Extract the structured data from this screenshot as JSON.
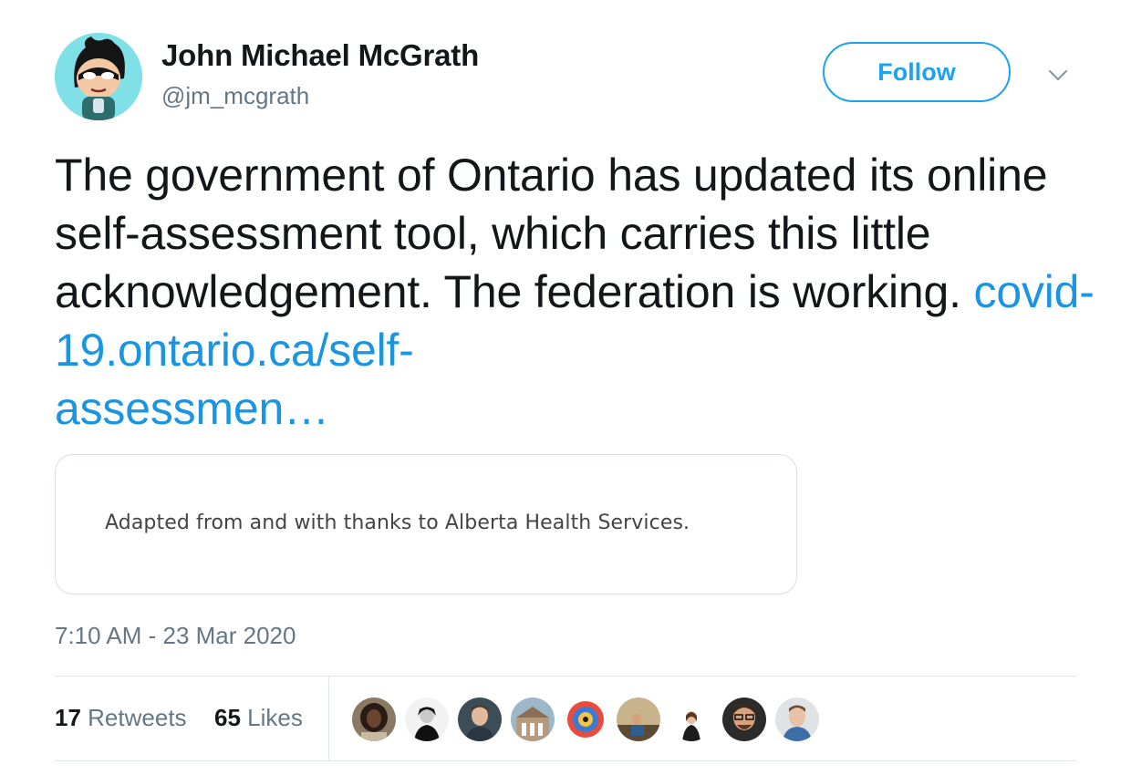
{
  "author": {
    "name": "John Michael McGrath",
    "handle": "@jm_mcgrath"
  },
  "follow_label": "Follow",
  "tweet": {
    "text": "The government of Ontario has updated its online self-assessment tool, which carries this little acknowledgement. The federation is working.",
    "link_line1": "covid-19.ontario.ca/self-",
    "link_line2": "assessmen…"
  },
  "card": {
    "text": "Adapted from and with thanks to Alberta Health Services."
  },
  "timestamp": "7:10 AM - 23 Mar 2020",
  "stats": {
    "retweets_count": "17",
    "retweets_label": "Retweets",
    "likes_count": "65",
    "likes_label": "Likes"
  },
  "colors": {
    "accent": "#1da1f2",
    "link": "#1b95e0",
    "secondary_text": "#657786",
    "border": "#e1e8ed"
  }
}
